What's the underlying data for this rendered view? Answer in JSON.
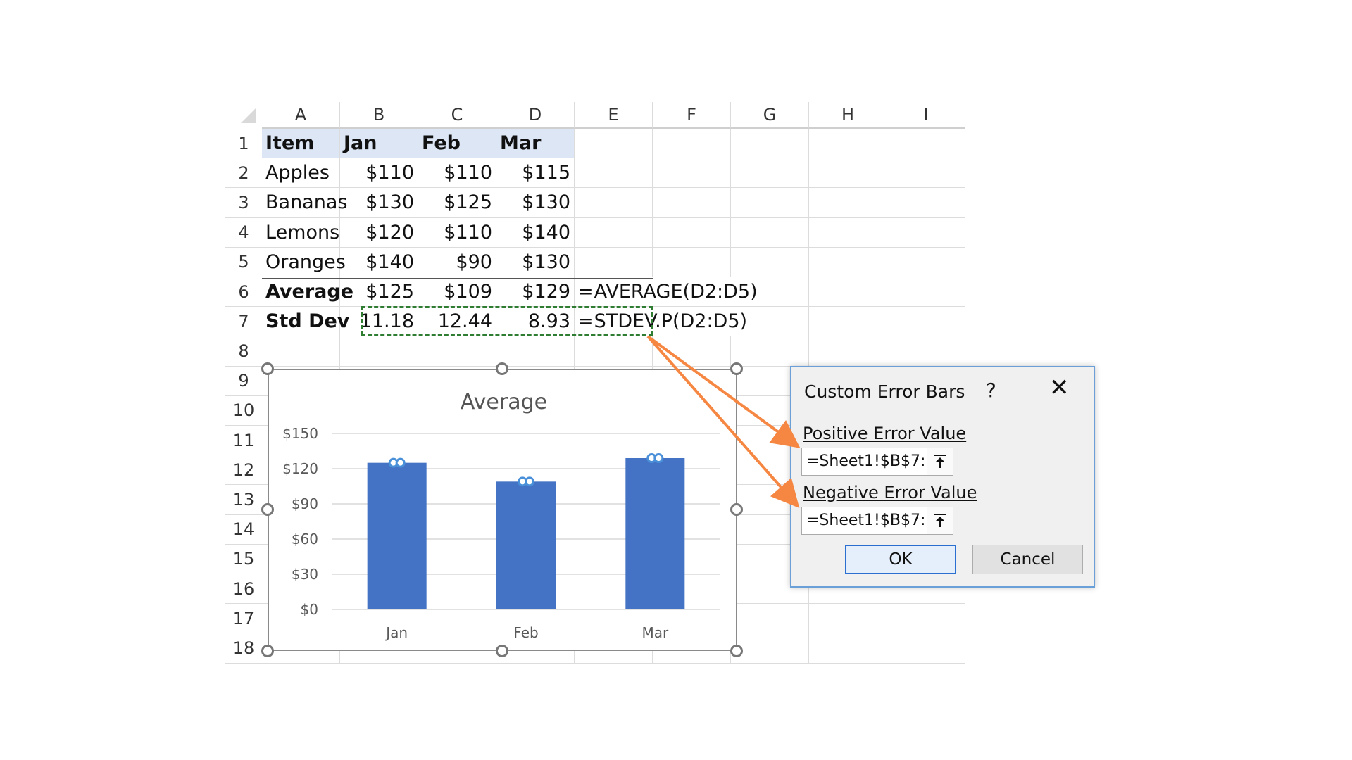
{
  "columns": [
    "A",
    "B",
    "C",
    "D",
    "E",
    "F",
    "G",
    "H",
    "I"
  ],
  "rows": [
    "1",
    "2",
    "3",
    "4",
    "5",
    "6",
    "7",
    "8",
    "9",
    "10",
    "11",
    "12",
    "13",
    "14",
    "15",
    "16",
    "17",
    "18"
  ],
  "table": {
    "header": [
      "Item",
      "Jan",
      "Feb",
      "Mar"
    ],
    "body": [
      [
        "Apples",
        "$110",
        "$110",
        "$115"
      ],
      [
        "Bananas",
        "$130",
        "$125",
        "$130"
      ],
      [
        "Lemons",
        "$120",
        "$110",
        "$140"
      ],
      [
        "Oranges",
        "$140",
        "$90",
        "$130"
      ],
      [
        "Average",
        "$125",
        "$109",
        "$129"
      ],
      [
        "Std Dev",
        "11.18",
        "12.44",
        "8.93"
      ]
    ]
  },
  "formulas": {
    "row6": "=AVERAGE(D2:D5)",
    "row7": "=STDEV.P(D2:D5)"
  },
  "chart_data": {
    "type": "bar",
    "title": "Average",
    "categories": [
      "Jan",
      "Feb",
      "Mar"
    ],
    "values": [
      125,
      109,
      129
    ],
    "error_bars": [
      11.18,
      12.44,
      8.93
    ],
    "ylim": [
      0,
      150
    ],
    "yticks": [
      "$0",
      "$30",
      "$60",
      "$90",
      "$120",
      "$150"
    ],
    "ytick_values": [
      0,
      30,
      60,
      90,
      120,
      150
    ],
    "grid": true,
    "bar_color": "#4472c4",
    "errorbar_color": "#4a90d9"
  },
  "dialog": {
    "title": "Custom Error Bars",
    "help": "?",
    "close": "✕",
    "positive_label": "Positive Error Value",
    "positive_value": "=Sheet1!$B$7:",
    "negative_label": "Negative Error Value",
    "negative_value": "=Sheet1!$B$7:",
    "ok_label": "OK",
    "cancel_label": "Cancel"
  },
  "colors": {
    "header_fill": "#dce6f5",
    "selection_marquee": "#2e7d32",
    "arrow": "#f58742",
    "dialog_border": "#6a9fd8"
  }
}
